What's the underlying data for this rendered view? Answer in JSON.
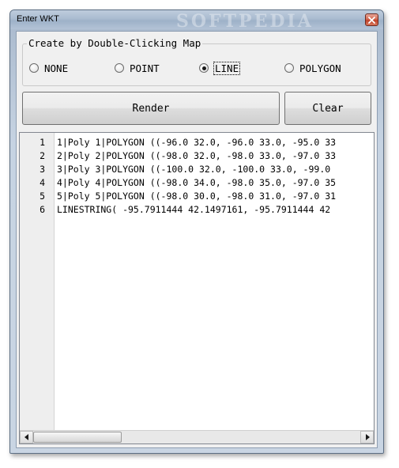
{
  "window": {
    "title": "Enter WKT",
    "watermark": "SOFTPEDIA"
  },
  "draw_mode": {
    "legend": "Create by Double-Clicking Map",
    "options": [
      {
        "label": "NONE",
        "selected": false
      },
      {
        "label": "POINT",
        "selected": false
      },
      {
        "label": "LINE",
        "selected": true
      },
      {
        "label": "POLYGON",
        "selected": false
      }
    ]
  },
  "buttons": {
    "render_label": "Render",
    "clear_label": "Clear"
  },
  "editor": {
    "line_numbers": [
      "1",
      "2",
      "3",
      "4",
      "5",
      "6"
    ],
    "lines": [
      "1|Poly 1|POLYGON ((-96.0 32.0, -96.0 33.0, -95.0 33",
      "2|Poly 2|POLYGON ((-98.0 32.0, -98.0 33.0, -97.0 33",
      "3|Poly 3|POLYGON ((-100.0 32.0, -100.0 33.0, -99.0",
      "4|Poly 4|POLYGON ((-98.0 34.0, -98.0 35.0, -97.0 35",
      "5|Poly 5|POLYGON ((-98.0 30.0, -98.0 31.0, -97.0 31",
      "LINESTRING( -95.7911444 42.1497161, -95.7911444 42"
    ]
  }
}
